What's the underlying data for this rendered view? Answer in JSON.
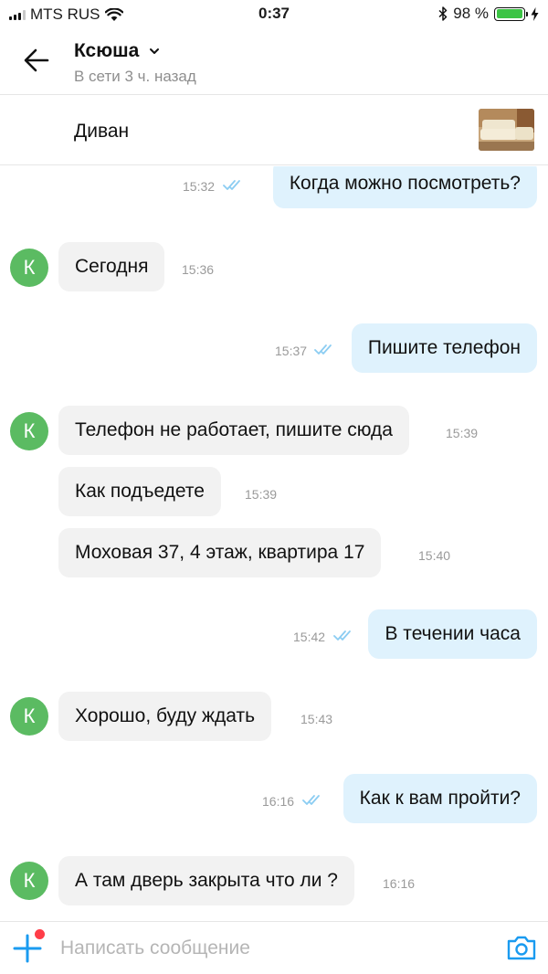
{
  "status_bar": {
    "carrier": "MTS RUS",
    "time": "0:37",
    "battery_percent": "98 %",
    "battery_level": 0.98
  },
  "header": {
    "contact_name": "Ксюша",
    "contact_status": "В сети 3 ч. назад"
  },
  "item": {
    "title": "Диван"
  },
  "messages": [
    {
      "direction": "out",
      "text": "Когда можно посмотреть?",
      "time": "15:32",
      "read": true
    },
    {
      "direction": "in",
      "avatar": "К",
      "text": "Сегодня",
      "time": "15:36"
    },
    {
      "direction": "out",
      "text": "Пишите телефон",
      "time": "15:37",
      "read": true
    },
    {
      "direction": "in",
      "avatar": "К",
      "text": "Телефон не работает, пишите сюда",
      "time": "15:39"
    },
    {
      "direction": "in",
      "text": "Как подъедете",
      "time": "15:39"
    },
    {
      "direction": "in",
      "text": "Моховая 37, 4 этаж, квартира 17",
      "time": "15:40"
    },
    {
      "direction": "out",
      "text": "В течении часа",
      "time": "15:42",
      "read": true
    },
    {
      "direction": "in",
      "avatar": "К",
      "text": "Хорошо, буду ждать",
      "time": "15:43"
    },
    {
      "direction": "out",
      "text": "Как к вам пройти?",
      "time": "16:16",
      "read": true
    },
    {
      "direction": "in",
      "avatar": "К",
      "text": "А там дверь закрыта что ли ?",
      "time": "16:16"
    }
  ],
  "composer": {
    "placeholder": "Написать сообщение"
  },
  "colors": {
    "outgoing_bubble": "#dff2fd",
    "incoming_bubble": "#f2f2f2",
    "avatar": "#5bbb62",
    "accent": "#1a9bf0",
    "notification_dot": "#ff3d48"
  }
}
